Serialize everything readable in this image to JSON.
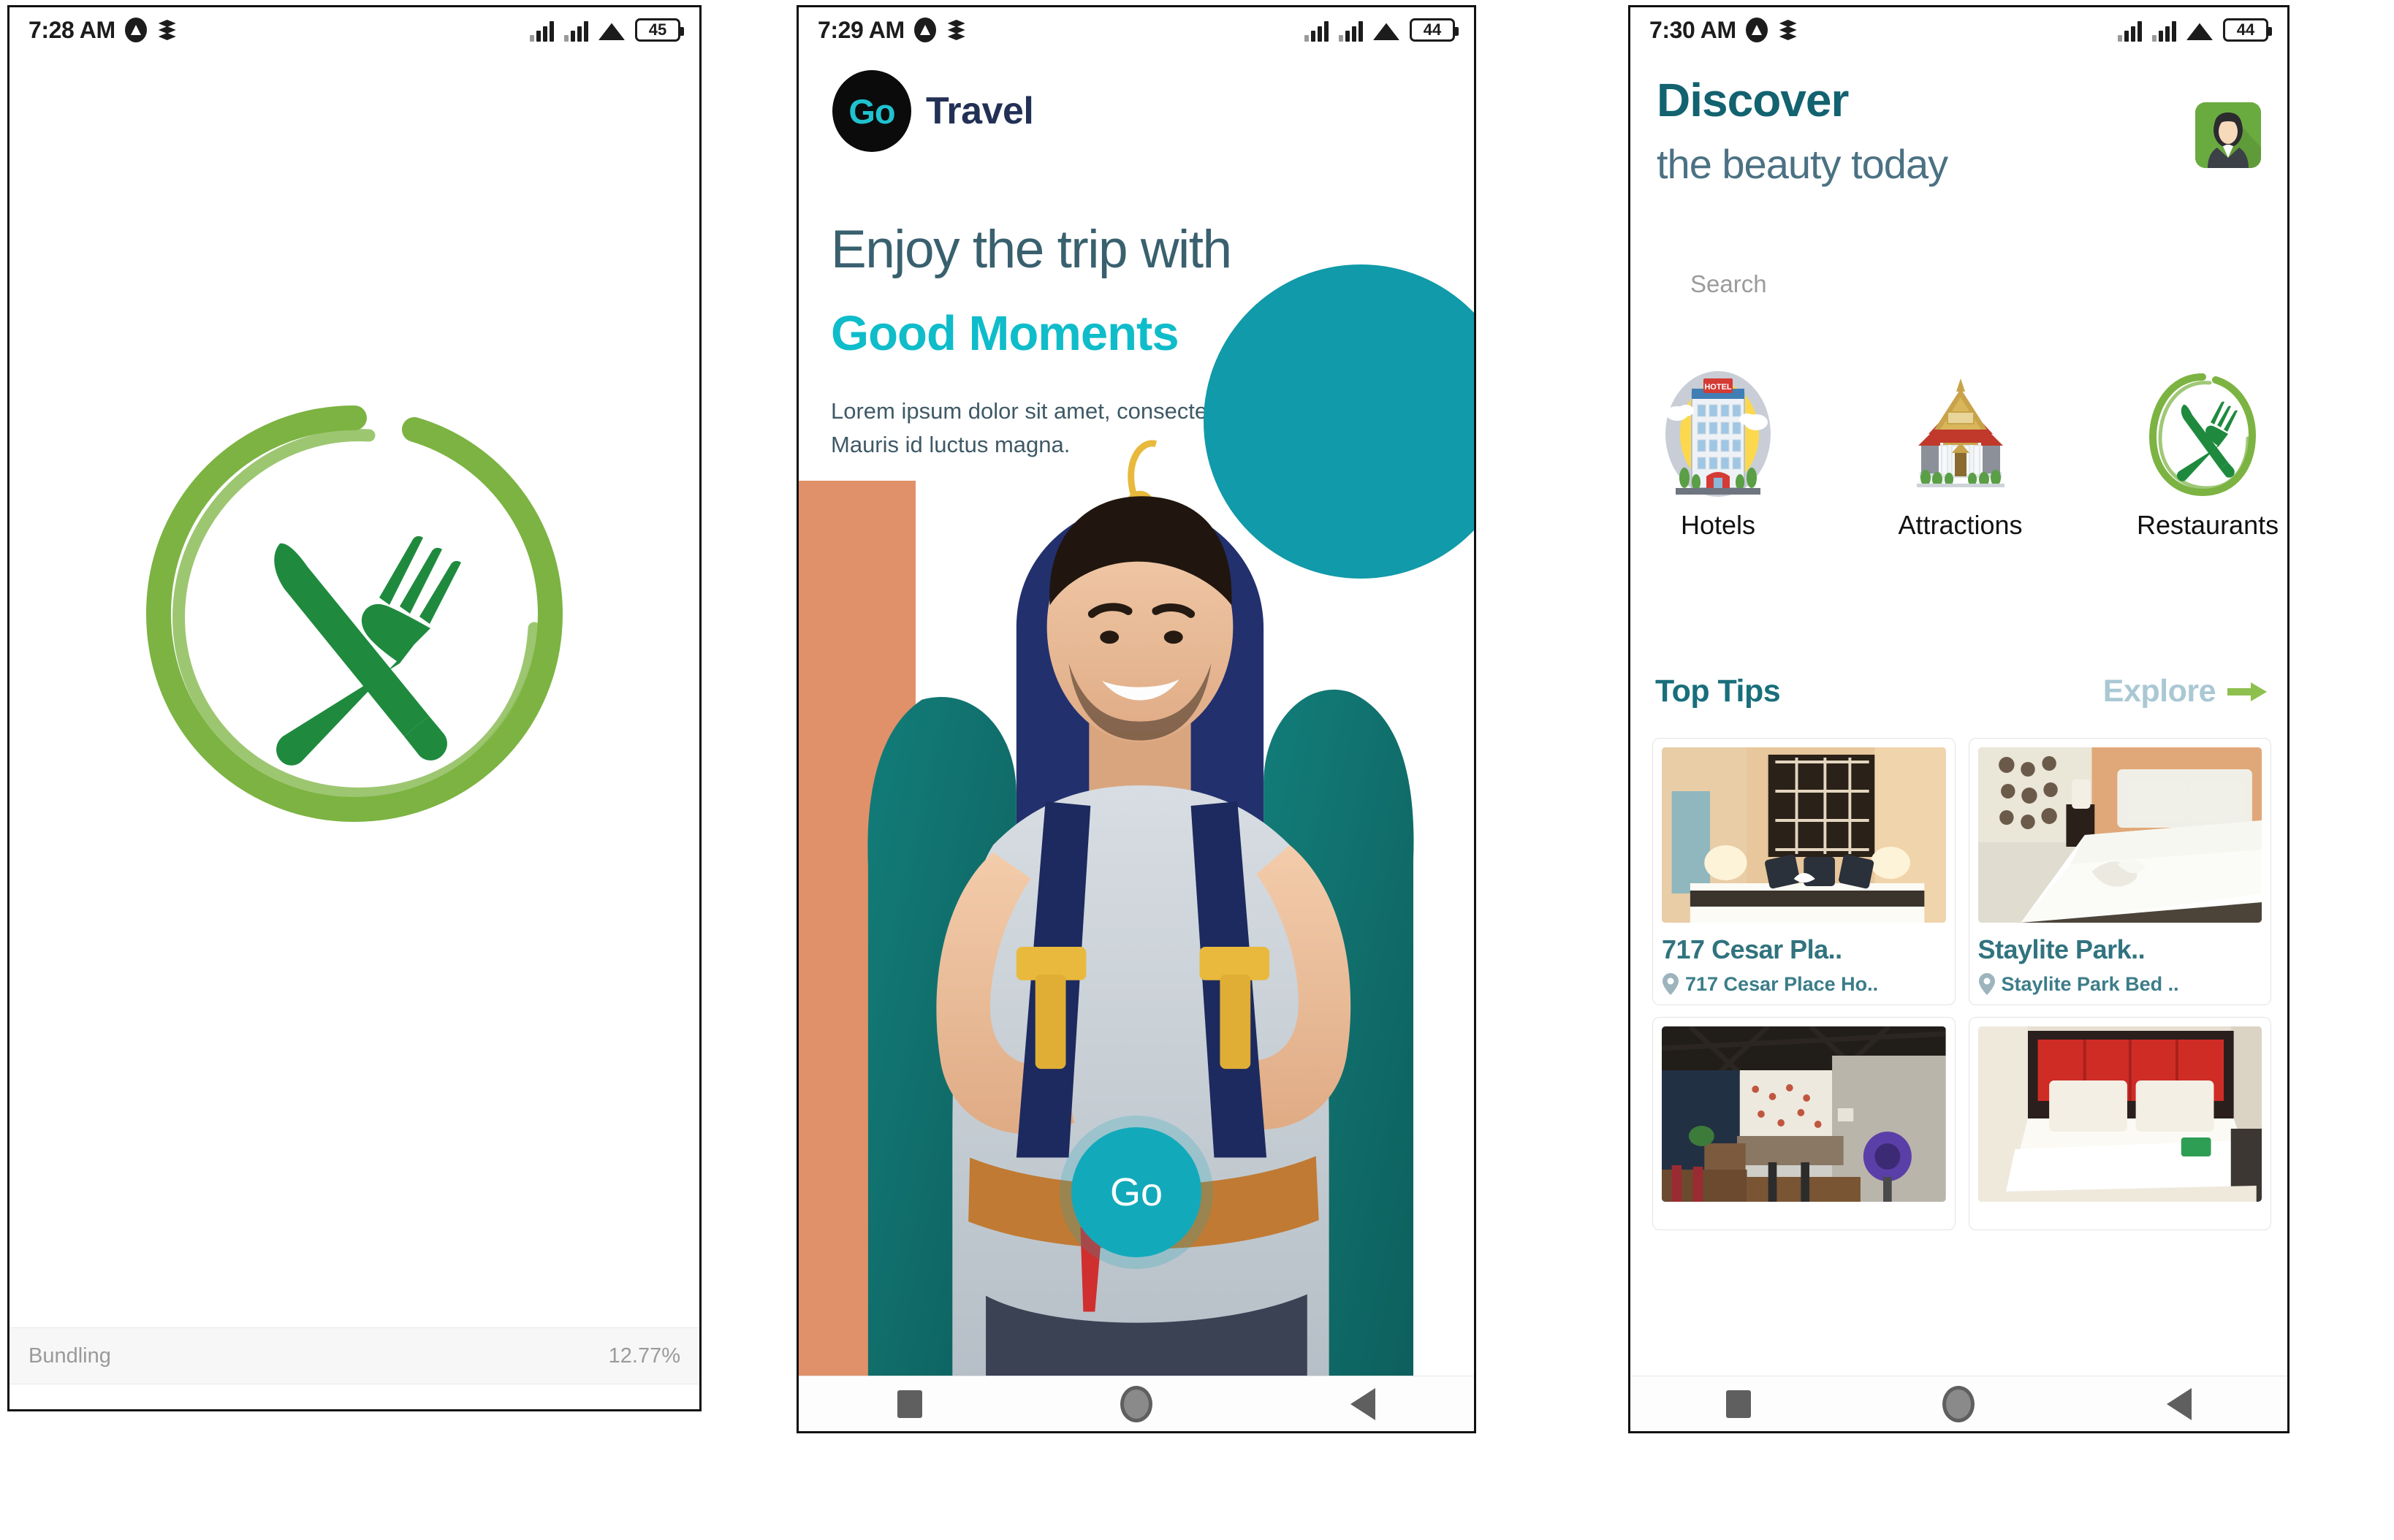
{
  "colors": {
    "brand_teal": "#12aabb",
    "brand_cyan": "#0fbcca",
    "deep_teal": "#12626f",
    "navy": "#223055",
    "leaf_green": "#6aab3f",
    "brush_green": "#7cb342",
    "cutlery_green": "#1f8a3e",
    "orange_block": "#e0916a",
    "blob_teal": "#119aa9",
    "arrow_green": "#8ec04f"
  },
  "panel1": {
    "status": {
      "time": "7:28 AM",
      "battery": "45",
      "icons": [
        "compass-icon",
        "layers-icon",
        "signal-icon",
        "signal-icon",
        "wifi-icon",
        "battery-icon"
      ]
    },
    "logo": {
      "name": "restaurant-brush-logo",
      "description": "green brush circle with crossed fork and knife"
    },
    "footer": {
      "label": "Bundling",
      "percent": "12.77%"
    }
  },
  "panel2": {
    "status": {
      "time": "7:29 AM",
      "battery": "44",
      "icons": [
        "compass-icon",
        "layers-icon",
        "signal-icon",
        "signal-icon",
        "wifi-icon",
        "battery-icon"
      ]
    },
    "brand": {
      "badge": "Go",
      "name": "Travel"
    },
    "headline_line1": "Enjoy the trip with",
    "headline_line2": "Good Moments",
    "body": "Lorem ipsum dolor sit amet, consectetur adipiscing elit. Mauris id luctus magna.",
    "hero": {
      "name": "backpacker-photo",
      "description": "smiling man wearing a large backpack"
    },
    "cta": "Go",
    "navbar": [
      "recents-square-icon",
      "home-circle-icon",
      "back-triangle-icon"
    ]
  },
  "panel3": {
    "status": {
      "time": "7:30 AM",
      "battery": "44",
      "icons": [
        "compass-icon",
        "layers-icon",
        "signal-icon",
        "signal-icon",
        "wifi-icon",
        "battery-icon"
      ]
    },
    "title": "Discover",
    "subtitle": "the beauty today",
    "avatar_alt": "user-avatar",
    "search": {
      "value": "",
      "placeholder": "Search"
    },
    "categories": [
      {
        "label": "Hotels",
        "icon": "hotel-building-icon"
      },
      {
        "label": "Attractions",
        "icon": "temple-icon"
      },
      {
        "label": "Restaurants",
        "icon": "fork-knife-circle-icon"
      }
    ],
    "section": {
      "title": "Top Tips",
      "action": "Explore",
      "action_icon": "arrow-right-icon"
    },
    "cards": [
      {
        "title": "717 Cesar Pla..",
        "location": "717 Cesar Place Ho..",
        "thumb": "hotel-room-dark-headboard"
      },
      {
        "title": "Staylite Park..",
        "location": "Staylite Park Bed ..",
        "thumb": "hotel-room-white-bed"
      },
      {
        "title": "",
        "location": "",
        "thumb": "cafe-interior"
      },
      {
        "title": "",
        "location": "",
        "thumb": "hotel-room-red-headboard"
      }
    ],
    "navbar": [
      "recents-square-icon",
      "home-circle-icon",
      "back-triangle-icon"
    ]
  }
}
